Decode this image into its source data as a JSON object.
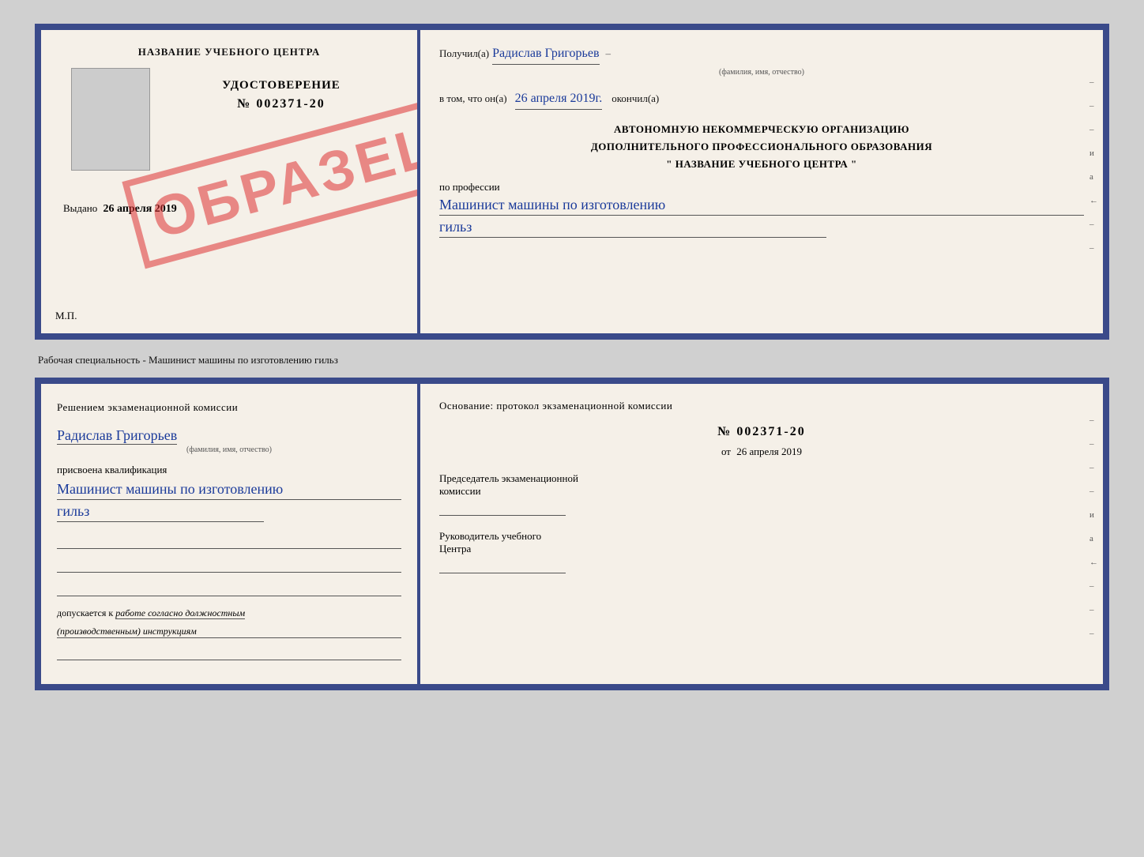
{
  "top_document": {
    "left": {
      "title": "НАЗВАНИЕ УЧЕБНОГО ЦЕНТРА",
      "cert_label": "УДОСТОВЕРЕНИЕ",
      "cert_number": "№ 002371-20",
      "issued_label": "Выдано",
      "issued_date": "26 апреля 2019",
      "mp_label": "М.П.",
      "sample_text": "ОБРАЗЕЦ"
    },
    "right": {
      "received_label": "Получил(а)",
      "person_name": "Радислав Григорьев",
      "name_sublabel": "(фамилия, имя, отчество)",
      "in_that_label": "в том, что он(а)",
      "completion_date": "26 апреля 2019г.",
      "finished_label": "окончил(а)",
      "org_line1": "АВТОНОМНУЮ НЕКОММЕРЧЕСКУЮ ОРГАНИЗАЦИЮ",
      "org_line2": "ДОПОЛНИТЕЛЬНОГО ПРОФЕССИОНАЛЬНОГО ОБРАЗОВАНИЯ",
      "org_line3": "\"  НАЗВАНИЕ УЧЕБНОГО ЦЕНТРА  \"",
      "profession_label": "по профессии",
      "profession_text": "Машинист машины по изготовлению",
      "profession_text2": "гильз",
      "side_marks": [
        "-",
        "-",
        "-",
        "и",
        "а",
        "←",
        "-",
        "-"
      ]
    }
  },
  "middle_label": "Рабочая специальность - Машинист машины по изготовлению гильз",
  "bottom_document": {
    "left": {
      "title": "Решением  экзаменационной  комиссии",
      "person_name": "Радислав Григорьев",
      "name_sublabel": "(фамилия, имя, отчество)",
      "assigned_label": "присвоена квалификация",
      "qualification_text": "Машинист машины по изготовлению",
      "qualification_text2": "гильз",
      "allowed_label": "допускается к",
      "allowed_text": "работе согласно должностным",
      "allowed_text2": "(производственным) инструкциям"
    },
    "right": {
      "basis_label": "Основание: протокол экзаменационной  комиссии",
      "protocol_number": "№  002371-20",
      "date_prefix": "от",
      "protocol_date": "26 апреля 2019",
      "chairman_label": "Председатель экзаменационной",
      "chairman_label2": "комиссии",
      "head_label": "Руководитель учебного",
      "head_label2": "Центра",
      "side_marks": [
        "-",
        "-",
        "-",
        "-",
        "и",
        "а",
        "←",
        "-",
        "-",
        "-"
      ]
    }
  }
}
